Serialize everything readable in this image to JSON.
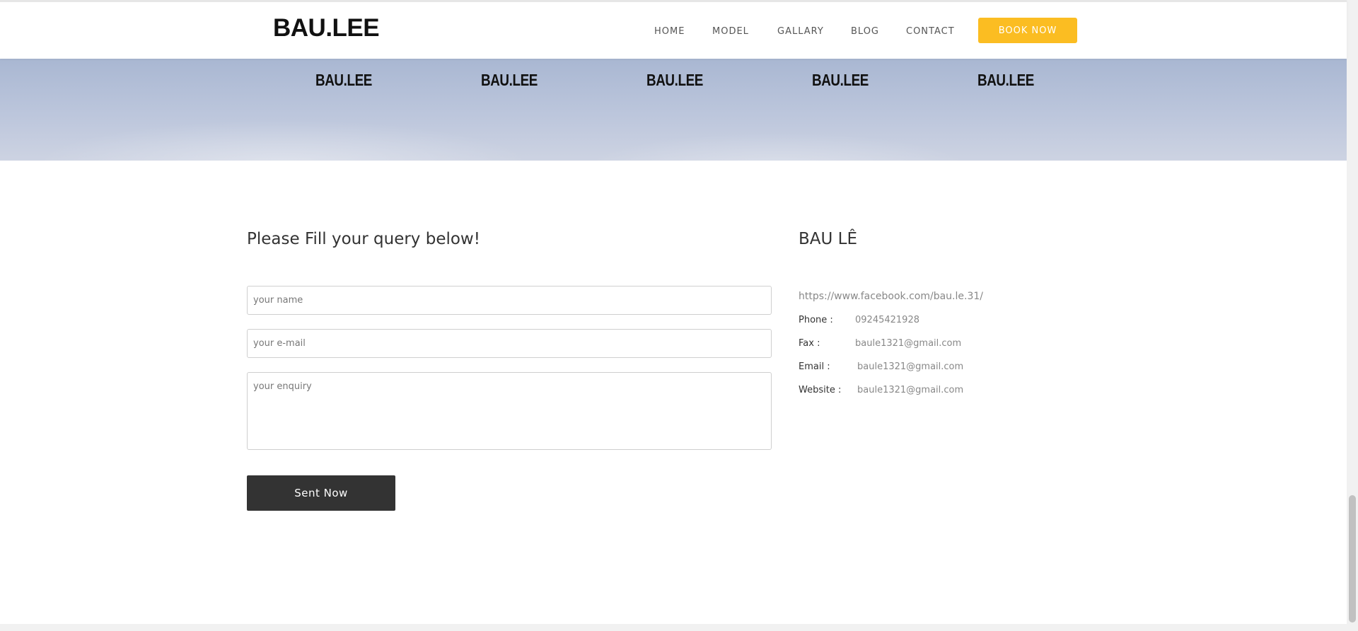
{
  "header": {
    "logo": "BAU.LEE",
    "nav": [
      {
        "label": "HOME"
      },
      {
        "label": "MODEL"
      },
      {
        "label": "GALLARY"
      },
      {
        "label": "BLOG"
      },
      {
        "label": "CONTACT"
      }
    ],
    "book_label": "BOOK NOW",
    "book_color": "#fbbd22"
  },
  "sky_logos": [
    "BAU.LEE",
    "BAU.LEE",
    "BAU.LEE",
    "BAU.LEE",
    "BAU.LEE"
  ],
  "form": {
    "title": "Please Fill your query below!",
    "name_placeholder": "your name",
    "email_placeholder": "your e-mail",
    "enquiry_placeholder": "your enquiry",
    "submit_label": "Sent Now"
  },
  "contact": {
    "title": "BAU LÊ",
    "facebook": "https://www.facebook.com/bau.le.31/",
    "rows": [
      {
        "label": "Phone :",
        "value": "09245421928"
      },
      {
        "label": "Fax :",
        "value": "baule1321@gmail.com"
      },
      {
        "label": "Email :",
        "value": "baule1321@gmail.com"
      },
      {
        "label": "Website :",
        "value": "baule1321@gmail.com"
      }
    ]
  }
}
